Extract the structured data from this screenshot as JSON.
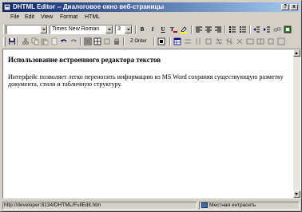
{
  "window": {
    "title": "DHTML Editor -- Диалоговое окно веб-страницы",
    "help_label": "?",
    "close_label": "x"
  },
  "menu": [
    "File",
    "Edit",
    "View",
    "Format",
    "HTML"
  ],
  "toolbar1": {
    "style_value": "",
    "font_value": "Times New Roman",
    "size_value": "3",
    "bold_label": "B",
    "italic_label": "I",
    "underline_label": "U"
  },
  "toolbar2": {
    "zorder_label": "Z Order"
  },
  "document": {
    "heading": "Использование встроенного редактора текстов",
    "paragraph": "Интерфейс позволяет легко переносить информацию из MS Word сохраняя существующую разметку документа, стили и табличную структуру."
  },
  "status": {
    "url": "http://developer:8134/DHTML/FullEdit.htm",
    "zone": "Местная интрасеть"
  }
}
